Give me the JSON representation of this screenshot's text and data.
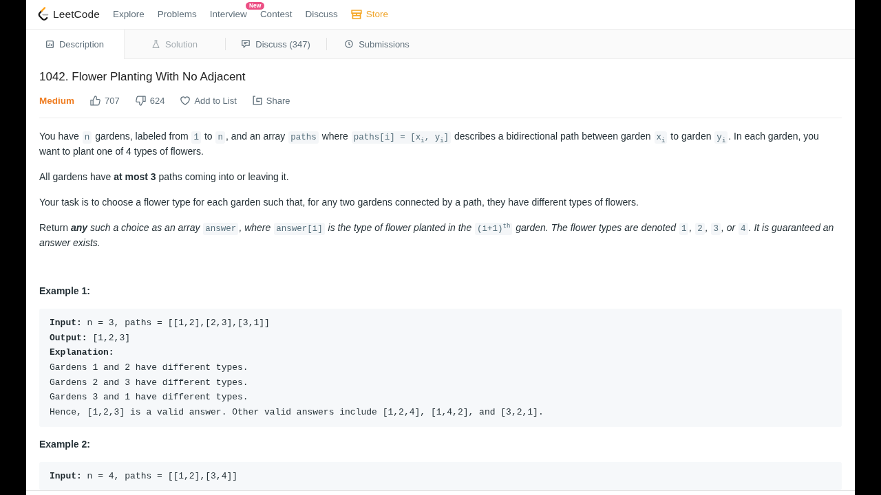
{
  "nav": {
    "logo": "LeetCode",
    "items": [
      {
        "kind": "link",
        "label": "Explore"
      },
      {
        "kind": "link",
        "label": "Problems"
      },
      {
        "kind": "link",
        "label": "Interview",
        "badge": "New"
      },
      {
        "kind": "link",
        "label": "Contest"
      },
      {
        "kind": "link",
        "label": "Discuss"
      },
      {
        "kind": "store",
        "label": "Store"
      }
    ]
  },
  "tabs": [
    {
      "kind": "description",
      "label": "Description",
      "selected": true,
      "disabled": false
    },
    {
      "kind": "solution",
      "label": "Solution",
      "selected": false,
      "disabled": true
    },
    {
      "kind": "discuss",
      "label": "Discuss (347)",
      "selected": false,
      "disabled": false
    },
    {
      "kind": "submissions",
      "label": "Submissions",
      "selected": false,
      "disabled": false
    }
  ],
  "problem": {
    "title": "1042. Flower Planting With No Adjacent",
    "difficulty": "Medium",
    "actions": [
      {
        "kind": "like",
        "label": "707"
      },
      {
        "kind": "dislike",
        "label": "624"
      },
      {
        "kind": "add-to-list",
        "label": "Add to List"
      },
      {
        "kind": "share",
        "label": "Share"
      }
    ],
    "paragraphs": [
      {
        "segments": [
          {
            "kind": "text",
            "text": "You have "
          },
          {
            "kind": "code",
            "text": "n"
          },
          {
            "kind": "text",
            "text": " gardens, labeled from "
          },
          {
            "kind": "code",
            "text": "1"
          },
          {
            "kind": "text",
            "text": " to "
          },
          {
            "kind": "code",
            "text": "n"
          },
          {
            "kind": "text",
            "text": ", and an array "
          },
          {
            "kind": "code",
            "text": "paths"
          },
          {
            "kind": "text",
            "text": " where "
          },
          {
            "kind": "code",
            "text": "paths[i] = [x$_{i}$, y$_{i}$]"
          },
          {
            "kind": "text",
            "text": " describes a bidirectional path between garden "
          },
          {
            "kind": "code",
            "text": "x$_{i}$"
          },
          {
            "kind": "text",
            "text": " to garden "
          },
          {
            "kind": "code",
            "text": "y$_{i}$"
          },
          {
            "kind": "text",
            "text": ". In each garden, you want to plant one of 4 types of flowers."
          }
        ]
      },
      {
        "segments": [
          {
            "kind": "text",
            "text": "All gardens have **at most 3** paths coming into or leaving it."
          }
        ]
      },
      {
        "segments": [
          {
            "kind": "text",
            "text": "Your task is to choose a flower type for each garden such that, for any two gardens connected by a path, they have different types of flowers."
          }
        ]
      },
      {
        "segments": [
          {
            "kind": "text",
            "text": "Return "
          },
          {
            "kind": "em",
            "text": "**any**"
          },
          {
            "kind": "em",
            "text": " such a choice as an array "
          },
          {
            "kind": "code",
            "text": "answer"
          },
          {
            "kind": "em",
            "text": ", where "
          },
          {
            "kind": "code",
            "text": "answer[i]"
          },
          {
            "kind": "em",
            "text": " is the type of flower planted in the "
          },
          {
            "kind": "code",
            "text": "(i+1)$^{th}$"
          },
          {
            "kind": "em",
            "text": " garden. The flower types are denoted "
          },
          {
            "kind": "code",
            "text": "1"
          },
          {
            "kind": "em",
            "text": ", "
          },
          {
            "kind": "code",
            "text": "2"
          },
          {
            "kind": "em",
            "text": ", "
          },
          {
            "kind": "code",
            "text": "3"
          },
          {
            "kind": "em",
            "text": ", or "
          },
          {
            "kind": "code",
            "text": "4"
          },
          {
            "kind": "em",
            "text": ". It is guaranteed an answer exists."
          }
        ]
      }
    ],
    "examples": [
      {
        "heading": "Example 1:",
        "lines": [
          "**Input:** n = 3, paths = [[1,2],[2,3],[3,1]]",
          "**Output:** [1,2,3]",
          "**Explanation:**",
          "Gardens 1 and 2 have different types.",
          "Gardens 2 and 3 have different types.",
          "Gardens 3 and 1 have different types.",
          "Hence, [1,2,3] is a valid answer. Other valid answers include [1,2,4], [1,4,2], and [3,2,1]."
        ]
      },
      {
        "heading": "Example 2:",
        "lines": [
          "**Input:** n = 4, paths = [[1,2],[3,4]]"
        ]
      }
    ]
  }
}
